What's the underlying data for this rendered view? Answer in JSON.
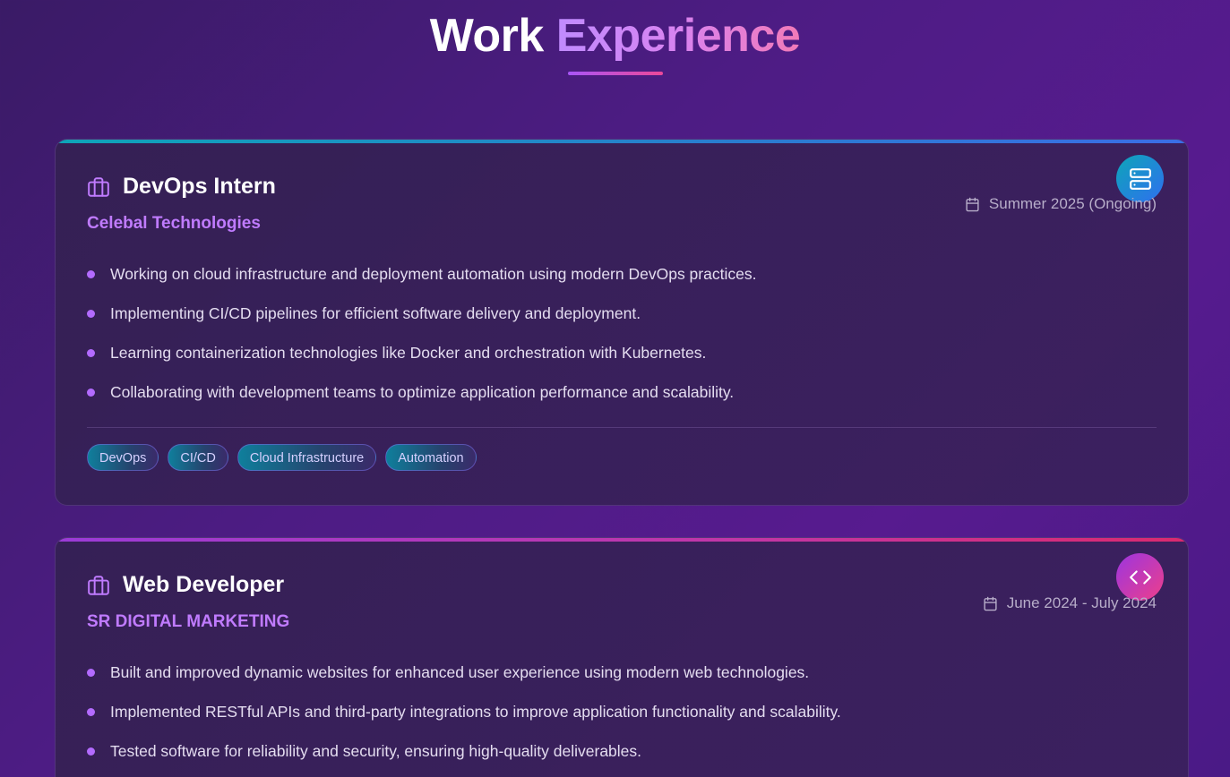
{
  "header": {
    "title_part1": "Work",
    "title_part2": "Experience"
  },
  "experiences": [
    {
      "role": "DevOps Intern",
      "company": "Celebal Technologies",
      "date": "Summer 2025 (Ongoing)",
      "badge_icon": "server-icon",
      "points": [
        "Working on cloud infrastructure and deployment automation using modern DevOps practices.",
        "Implementing CI/CD pipelines for efficient software delivery and deployment.",
        "Learning containerization technologies like Docker and orchestration with Kubernetes.",
        "Collaborating with development teams to optimize application performance and scalability."
      ],
      "tags": [
        "DevOps",
        "CI/CD",
        "Cloud Infrastructure",
        "Automation"
      ]
    },
    {
      "role": "Web Developer",
      "company": "SR DIGITAL MARKETING",
      "date": "June 2024 - July 2024",
      "badge_icon": "code-icon",
      "points": [
        "Built and improved dynamic websites for enhanced user experience using modern web technologies.",
        "Implemented RESTful APIs and third-party integrations to improve application functionality and scalability.",
        "Tested software for reliability and security, ensuring high-quality deliverables."
      ]
    }
  ],
  "colors": {
    "accent_purple": "#c07bff",
    "accent_pink": "#ec4899",
    "cyan_start": "#0ea5b8",
    "blue_end": "#2f6ff0"
  }
}
